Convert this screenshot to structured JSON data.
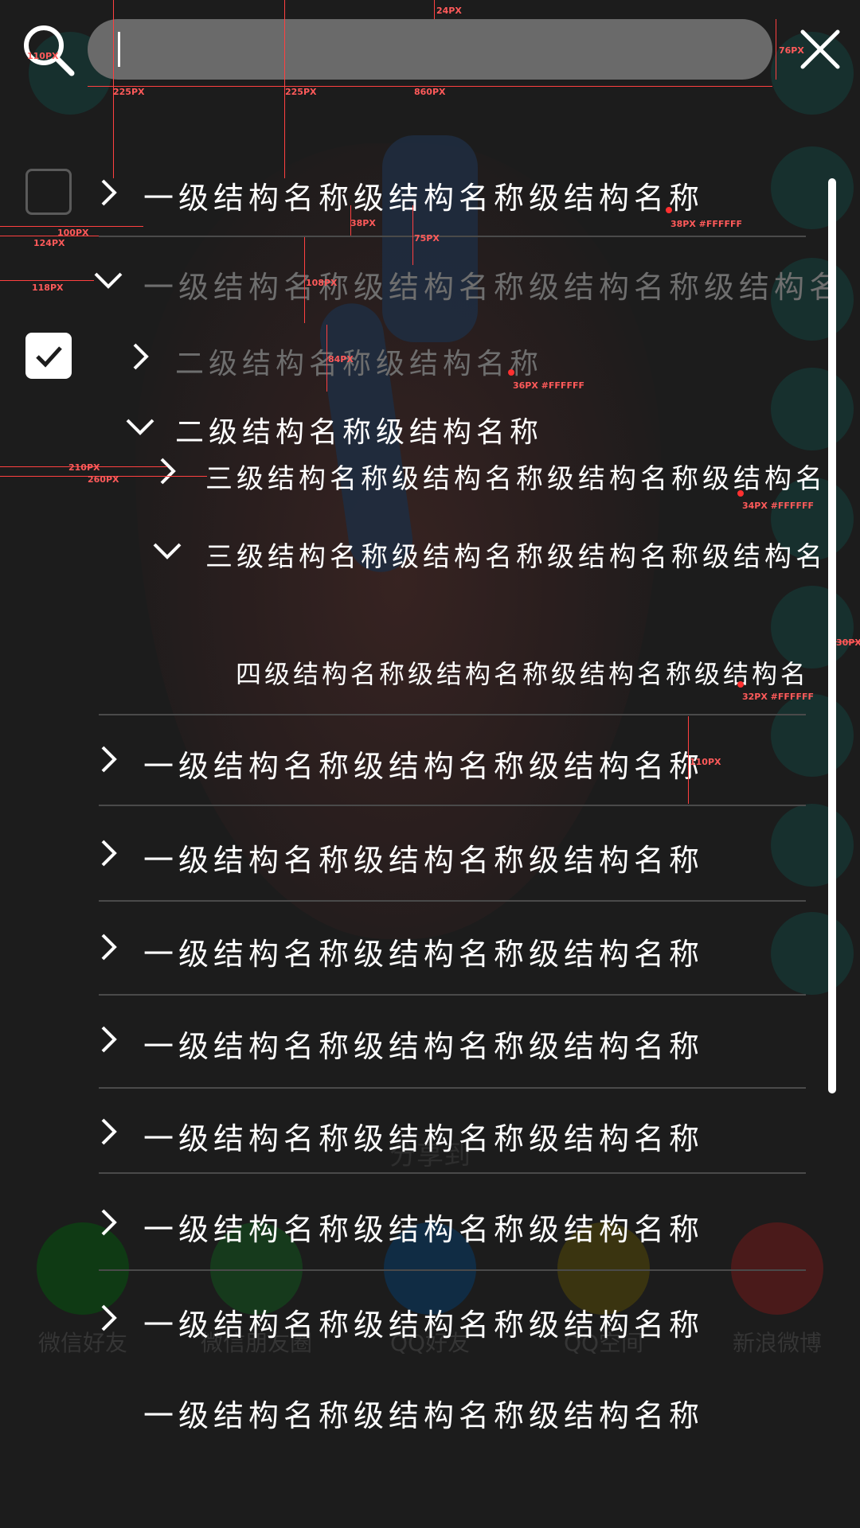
{
  "search": {
    "value": "",
    "placeholder": ""
  },
  "background": {
    "share_title": "分享到",
    "share_targets": [
      "微信好友",
      "微信朋友圈",
      "QQ好友",
      "QQ空间",
      "新浪微博"
    ]
  },
  "tree": {
    "level1_rows": [
      {
        "label": "一级结构名称级结构名称级结构名称",
        "expanded": false,
        "checked": false
      },
      {
        "label": "一级结构名称级结构名称级结构名称级结构名",
        "expanded": true
      },
      {
        "label": "一级结构名称级结构名称级结构名称",
        "expanded": false
      },
      {
        "label": "一级结构名称级结构名称级结构名称",
        "expanded": false
      },
      {
        "label": "一级结构名称级结构名称级结构名称",
        "expanded": false
      },
      {
        "label": "一级结构名称级结构名称级结构名称",
        "expanded": false
      },
      {
        "label": "一级结构名称级结构名称级结构名称",
        "expanded": false
      },
      {
        "label": "一级结构名称级结构名称级结构名称",
        "expanded": false
      },
      {
        "label": "一级结构名称级结构名称级结构名称",
        "expanded": false
      },
      {
        "label": "一级结构名称级结构名称级结构名称"
      }
    ],
    "level2_rows": [
      {
        "label": "二级结构名称级结构名称",
        "expanded": false,
        "checked": true
      },
      {
        "label": "二级结构名称级结构名称",
        "expanded": true
      }
    ],
    "level3_rows": [
      {
        "label": "三级结构名称级结构名称级结构名称级结构名",
        "expanded": false
      },
      {
        "label": "三级结构名称级结构名称级结构名称级结构名",
        "expanded": true
      }
    ],
    "level4_rows": [
      {
        "label": "四级结构名称级结构名称级结构名称级结构名"
      }
    ]
  },
  "annotations": {
    "search_icon_size": "110PX",
    "field_top": "24PX",
    "field_height": "76PX",
    "field_left": "225PX",
    "field_left_edge": "225PX",
    "field_width": "860PX",
    "row_text_spec": "38PX #FFFFFF",
    "row_gap": "38PX",
    "row_gap_b": "75PX",
    "checkbox_x": "100PX",
    "indent_1": "124PX",
    "indent_chev": "118PX",
    "row_height_b": "108PX",
    "row_height_l2": "84PX",
    "l2_text_spec": "36PX #FFFFFF",
    "indent_3a": "210PX",
    "indent_3b": "260PX",
    "l3_text_spec": "34PX #FFFFFF",
    "side_width": "30PX",
    "l4_text_spec": "32PX #FFFFFF",
    "row_height": "110PX"
  },
  "colors": {
    "background": "#1c1c1c",
    "field": "#6a6a6a",
    "text": "#ffffff",
    "dim_text": "#6e6e6e",
    "divider": "#4a4a4a",
    "annotation": "#ff4040"
  }
}
